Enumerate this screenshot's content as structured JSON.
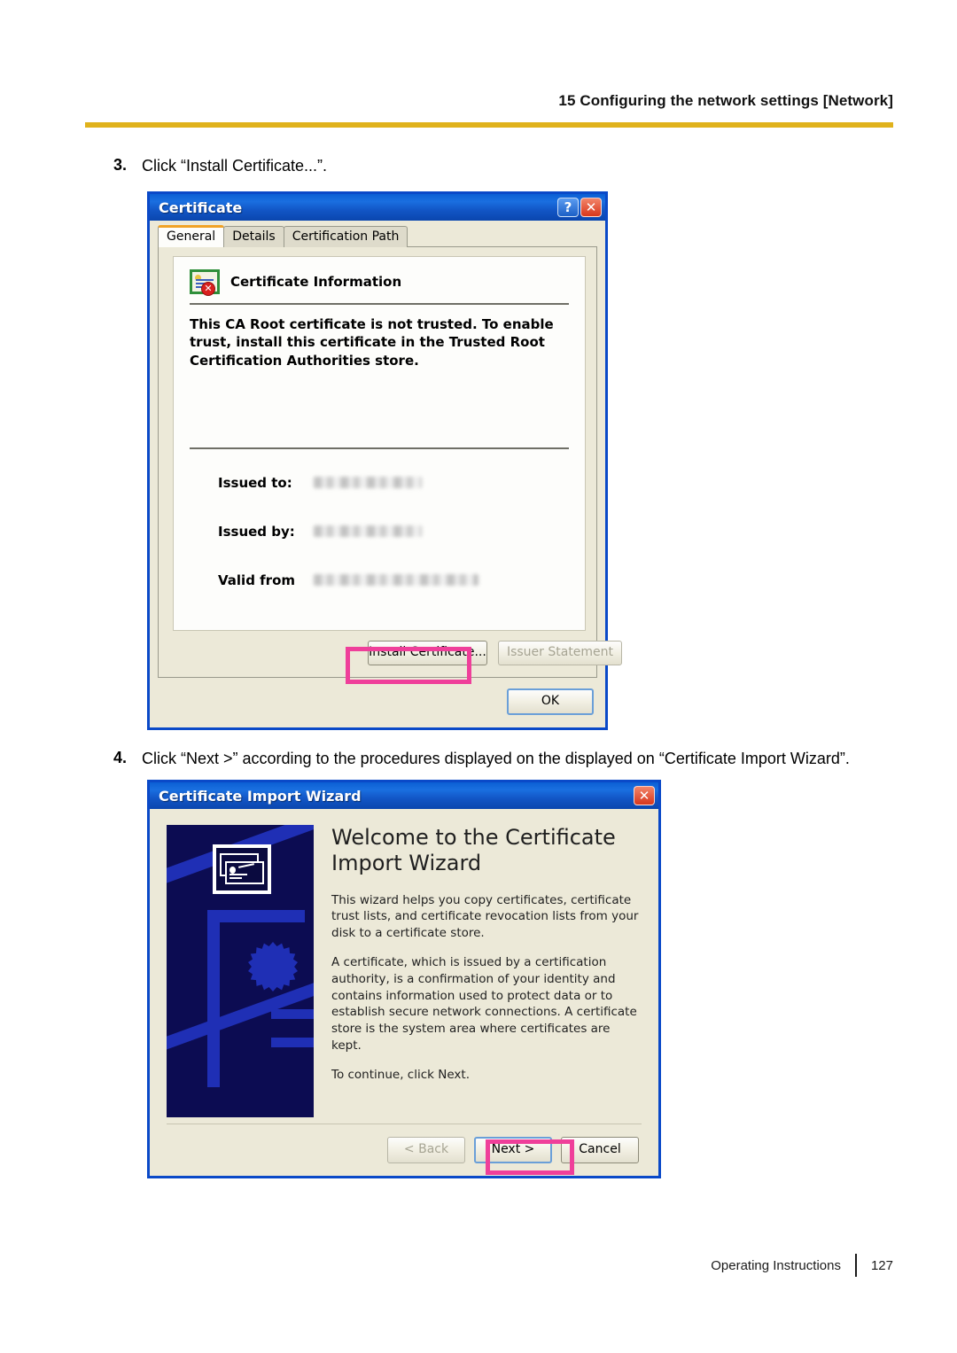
{
  "page": {
    "header_title": "15 Configuring the network settings [Network]",
    "header_rule_color": "#e0b21c",
    "footer_label": "Operating Instructions",
    "footer_page_number": "127",
    "callout_color": "#ef3f9a"
  },
  "steps": [
    {
      "number": "3.",
      "text": "Click “Install Certificate...”."
    },
    {
      "number": "4.",
      "text": "Click “Next >” according to the procedures displayed on the displayed on “Certificate Import Wizard”."
    }
  ],
  "certificate_dialog": {
    "title": "Certificate",
    "help_button": "?",
    "close_button": "✕",
    "tabs": [
      {
        "label": "General",
        "active": true
      },
      {
        "label": "Details",
        "active": false
      },
      {
        "label": "Certification Path",
        "active": false
      }
    ],
    "info_heading": "Certificate Information",
    "warning_text": "This CA Root certificate is not trusted. To enable trust, install this certificate in the Trusted Root Certification Authorities store.",
    "fields": [
      {
        "label": "Issued to:",
        "value": ""
      },
      {
        "label": "Issued by:",
        "value": ""
      },
      {
        "label": "Valid from",
        "value": ""
      }
    ],
    "install_certificate_button": "Install Certificate...",
    "issuer_statement_button": "Issuer Statement",
    "ok_button": "OK"
  },
  "wizard_dialog": {
    "title": "Certificate Import Wizard",
    "close_button": "✕",
    "heading": "Welcome to the Certificate Import Wizard",
    "paragraphs": [
      "This wizard helps you copy certificates, certificate trust lists, and certificate revocation lists from your disk to a certificate store.",
      "A certificate, which is issued by a certification authority, is a confirmation of your identity and contains information used to protect data or to establish secure network connections. A certificate store is the system area where certificates are kept.",
      "To continue, click Next."
    ],
    "back_button": "< Back",
    "next_button": "Next >",
    "cancel_button": "Cancel"
  }
}
